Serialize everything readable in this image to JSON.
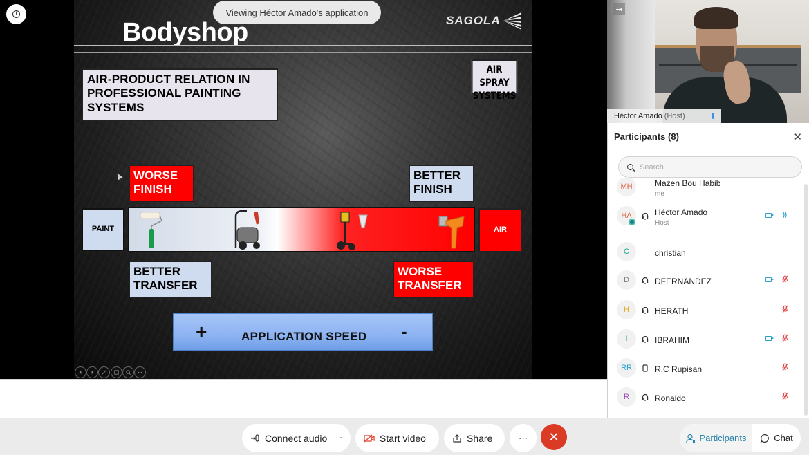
{
  "meeting": {
    "viewing_banner": "Viewing Héctor Amado's application"
  },
  "slide": {
    "title": "Bodyshop",
    "brand": "SAGOLA",
    "heading": "AIR-PRODUCT RELATION IN PROFESSIONAL PAINTING SYSTEMS",
    "category_badge": "AIR SPRAY SYSTEMS",
    "worse_finish": "WORSE FINISH",
    "better_finish": "BETTER FINISH",
    "paint_label": "PAINT",
    "air_label": "AIR",
    "better_transfer": "BETTER TRANSFER",
    "worse_transfer": "WORSE TRANSFER",
    "speed_plus": "+",
    "speed_label": "APPLICATION SPEED",
    "speed_minus": "-",
    "colors": {
      "red": "#ff0000",
      "light_blue": "#cfdcef",
      "speed_blue": "#8db3f2"
    },
    "toolbar": [
      "previous",
      "next",
      "pen",
      "slides",
      "zoom",
      "more"
    ]
  },
  "video": {
    "name": "Héctor Amado",
    "role": "(Host)"
  },
  "participants": {
    "title": "Participants (8)",
    "search_placeholder": "Search",
    "list": [
      {
        "initials": "MH",
        "name": "Mazen Bou Habib",
        "sub": "me",
        "color": "#e0633f",
        "headset": false,
        "video": false,
        "mic": "none",
        "presence": false
      },
      {
        "initials": "HA",
        "name": "Héctor Amado",
        "sub": "Host",
        "color": "#e0633f",
        "headset": true,
        "video": true,
        "mic": "speaking",
        "presence": true
      },
      {
        "initials": "C",
        "name": "christian",
        "sub": "",
        "color": "#1da58a",
        "headset": false,
        "video": false,
        "mic": "none",
        "presence": false
      },
      {
        "initials": "D",
        "name": "DFERNANDEZ",
        "sub": "",
        "color": "#777777",
        "headset": true,
        "video": true,
        "mic": "muted",
        "presence": false
      },
      {
        "initials": "H",
        "name": "HERATH",
        "sub": "",
        "color": "#e9a92b",
        "headset": true,
        "video": false,
        "mic": "muted",
        "presence": false
      },
      {
        "initials": "I",
        "name": "IBRAHIM",
        "sub": "",
        "color": "#1da58a",
        "headset": true,
        "video": true,
        "mic": "muted",
        "presence": false
      },
      {
        "initials": "RR",
        "name": "R.C Rupisan",
        "sub": "",
        "color": "#2a9fd0",
        "headset": false,
        "phone": true,
        "video": false,
        "mic": "muted",
        "presence": false
      },
      {
        "initials": "R",
        "name": "Ronaldo",
        "sub": "",
        "color": "#9b4fb5",
        "headset": true,
        "video": false,
        "mic": "muted",
        "presence": false
      }
    ]
  },
  "controls": {
    "connect_audio": "Connect audio",
    "start_video": "Start video",
    "share": "Share",
    "more": "···",
    "leave": "✕",
    "participants_tab": "Participants",
    "chat_tab": "Chat",
    "leave_color": "#db3a25",
    "accent": "#2784a8"
  }
}
